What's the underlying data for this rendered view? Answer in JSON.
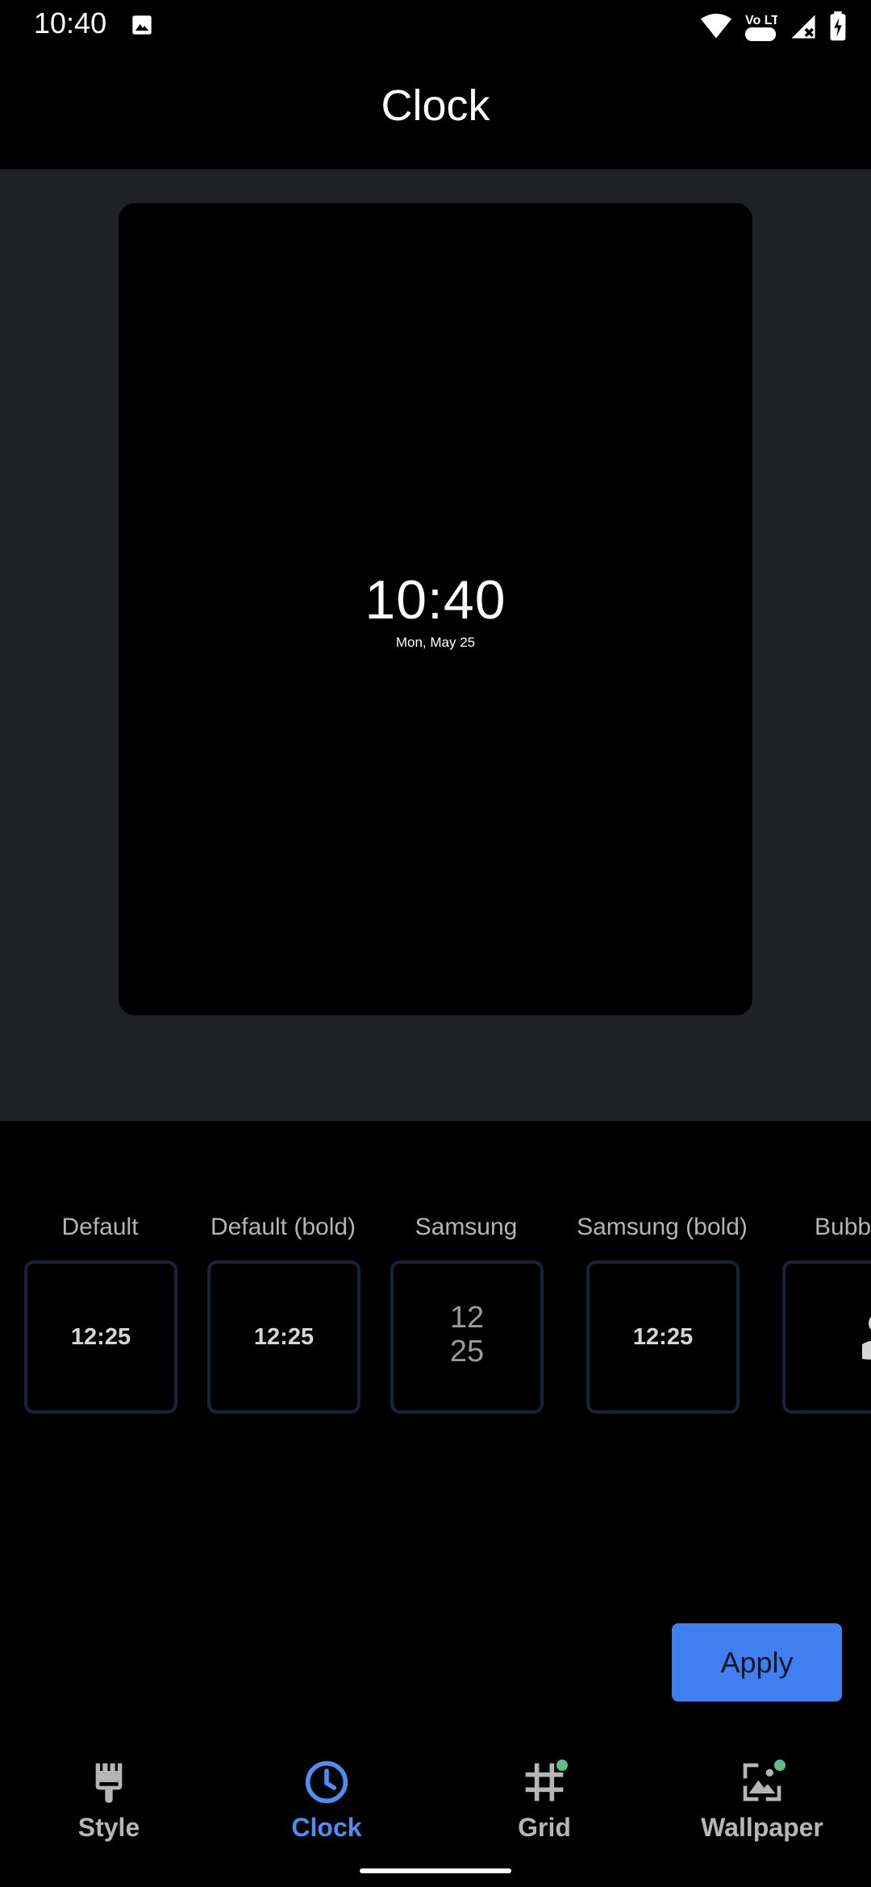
{
  "status_bar": {
    "time": "10:40",
    "icons": [
      "image-icon",
      "wifi-icon",
      "volte-icon",
      "signal-icon",
      "battery-charging-icon"
    ],
    "volte_text": "Vo LTE"
  },
  "header": {
    "title": "Clock"
  },
  "preview": {
    "time": "10:40",
    "date": "Mon, May 25"
  },
  "clock_options": [
    {
      "label": "Default",
      "sample": "12:25"
    },
    {
      "label": "Default (bold)",
      "sample": "12:25"
    },
    {
      "label": "Samsung",
      "sample_line1": "12",
      "sample_line2": "25"
    },
    {
      "label": "Samsung (bold)",
      "sample": "12:25"
    },
    {
      "label": "Bubble"
    }
  ],
  "apply_label": "Apply",
  "bottom_nav": [
    {
      "label": "Style",
      "icon": "brush-icon",
      "active": false,
      "badge": false
    },
    {
      "label": "Clock",
      "icon": "clock-icon",
      "active": true,
      "badge": false
    },
    {
      "label": "Grid",
      "icon": "grid-icon",
      "active": false,
      "badge": true
    },
    {
      "label": "Wallpaper",
      "icon": "wallpaper-icon",
      "active": false,
      "badge": true
    }
  ],
  "colors": {
    "accent": "#4d8ef0",
    "apply_button": "#3f7ff0",
    "badge": "#5fc085",
    "preview_background": "#202124"
  }
}
